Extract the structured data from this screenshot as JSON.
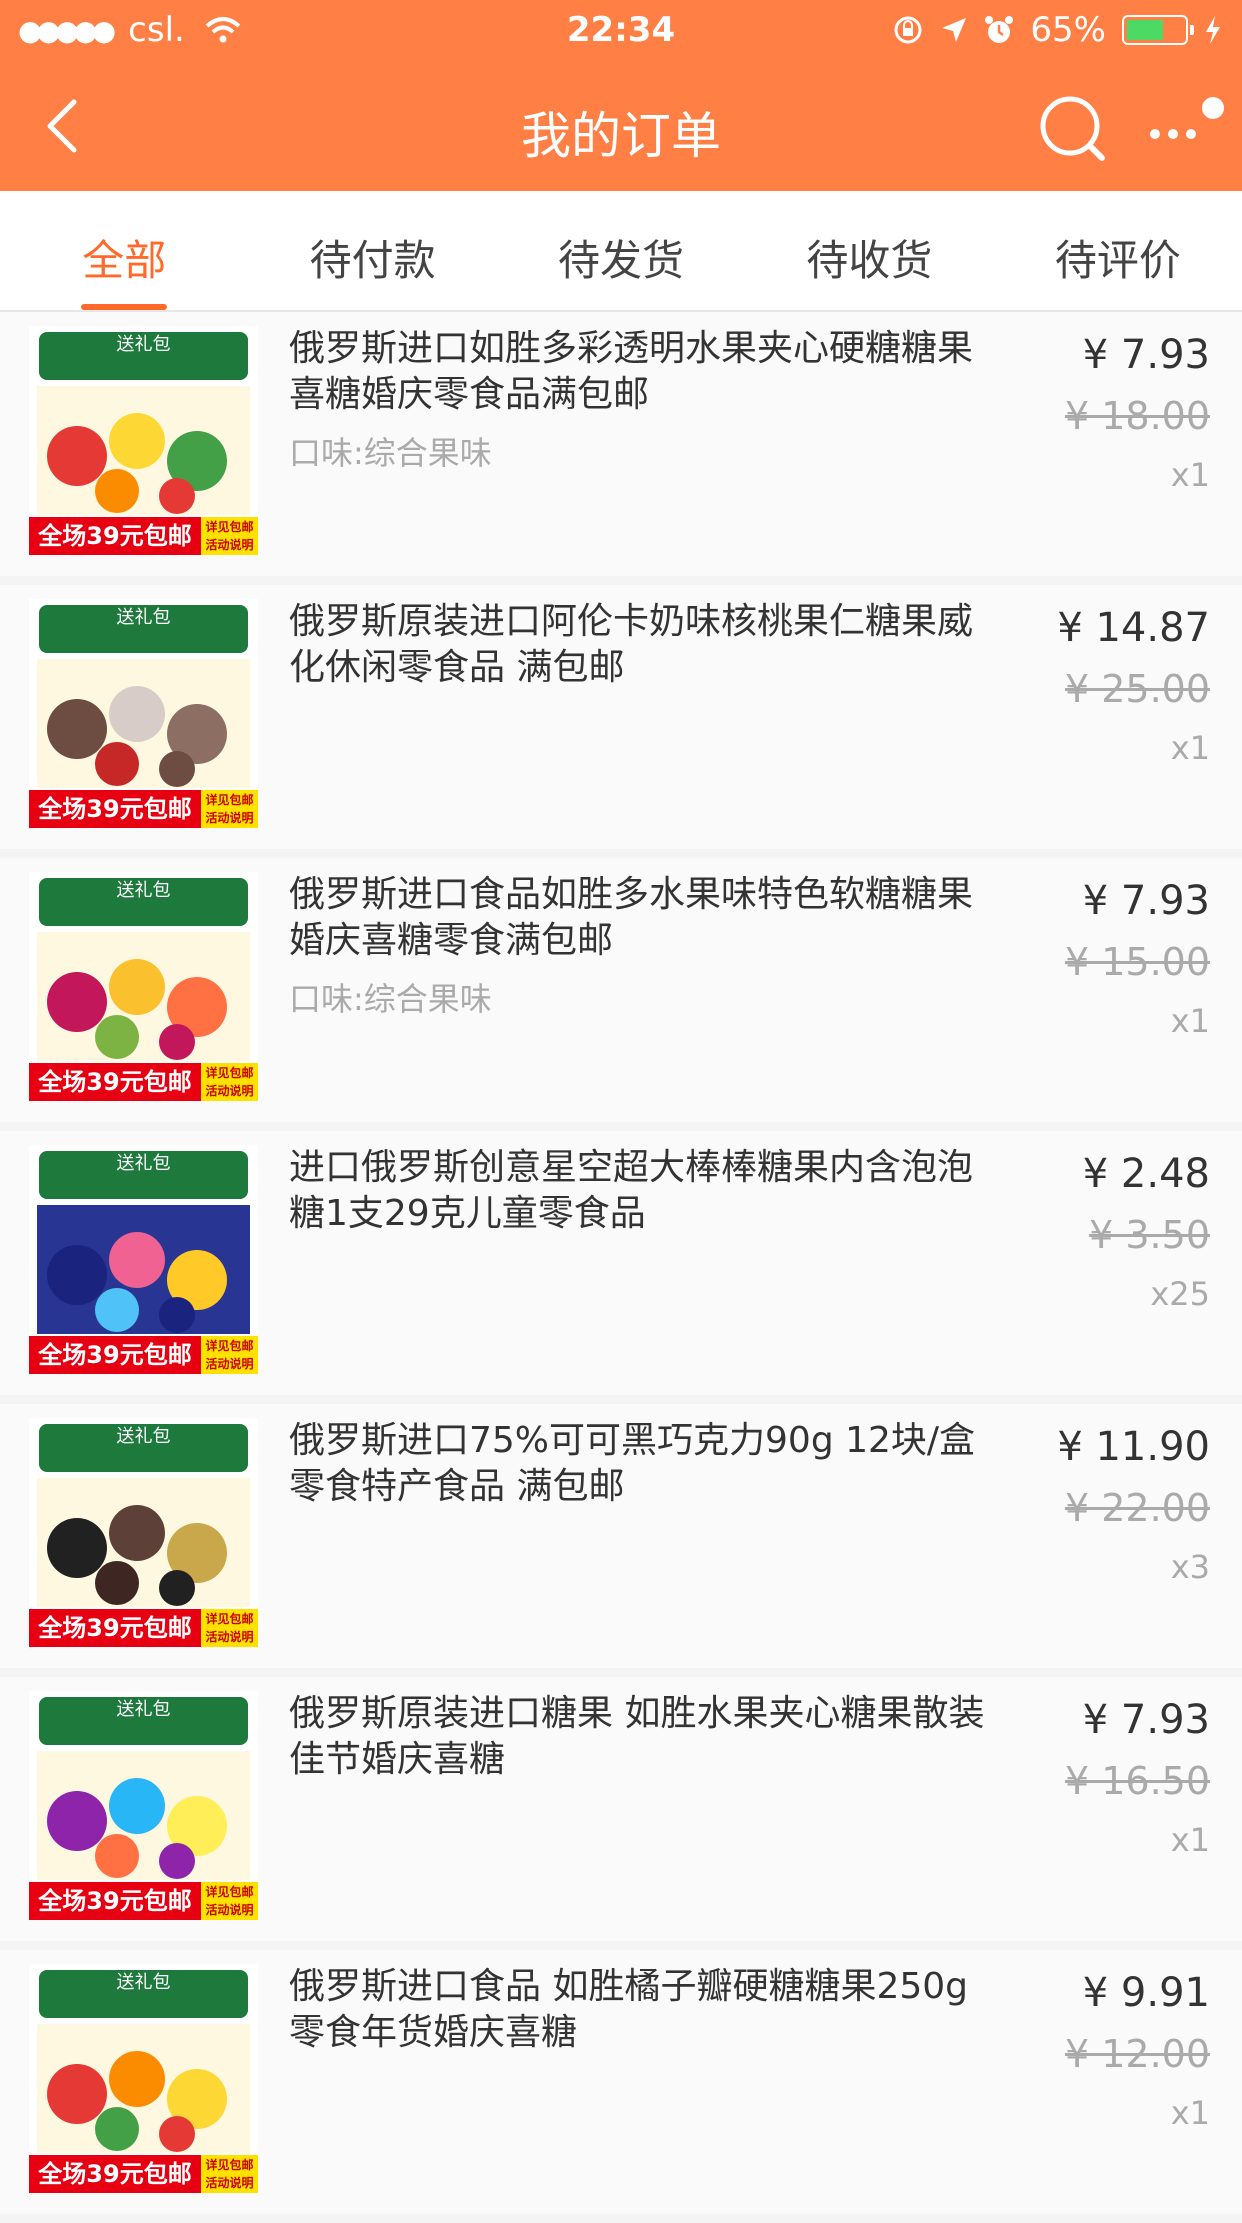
{
  "status_bar": {
    "signal": "●●●●●",
    "carrier": "csl.",
    "time": "22:34",
    "battery": "65%",
    "battery_level": 0.65
  },
  "nav": {
    "title": "我的订单"
  },
  "tabs": [
    {
      "label": "全部",
      "active": true
    },
    {
      "label": "待付款",
      "active": false
    },
    {
      "label": "待发货",
      "active": false
    },
    {
      "label": "待收货",
      "active": false
    },
    {
      "label": "待评价",
      "active": false
    }
  ],
  "thumbnail_text": {
    "banner": "送礼包",
    "promo": "全场39元包邮",
    "promo_side": "详见包邮 活动说明"
  },
  "orders": [
    {
      "name": "俄罗斯进口如胜多彩透明水果夹心硬糖糖果 喜糖婚庆零食品满包邮",
      "spec": "口味:综合果味",
      "price": "¥ 7.93",
      "original_price": "¥ 18.00",
      "quantity": "x1"
    },
    {
      "name": "俄罗斯原装进口阿伦卡奶味核桃果仁糖果威化休闲零食品 满包邮",
      "spec": "",
      "price": "¥ 14.87",
      "original_price": "¥ 25.00",
      "quantity": "x1"
    },
    {
      "name": "俄罗斯进口食品如胜多水果味特色软糖糖果 婚庆喜糖零食满包邮",
      "spec": "口味:综合果味",
      "price": "¥ 7.93",
      "original_price": "¥ 15.00",
      "quantity": "x1"
    },
    {
      "name": "进口俄罗斯创意星空超大棒棒糖果内含泡泡糖1支29克儿童零食品",
      "spec": "",
      "price": "¥ 2.48",
      "original_price": "¥ 3.50",
      "quantity": "x25"
    },
    {
      "name": "俄罗斯进口75%可可黑巧克力90g 12块/盒零食特产食品 满包邮",
      "spec": "",
      "price": "¥ 11.90",
      "original_price": "¥ 22.00",
      "quantity": "x3"
    },
    {
      "name": "俄罗斯原装进口糖果 如胜水果夹心糖果散装佳节婚庆喜糖",
      "spec": "",
      "price": "¥ 7.93",
      "original_price": "¥ 16.50",
      "quantity": "x1"
    },
    {
      "name": "俄罗斯进口食品 如胜橘子瓣硬糖糖果250g零食年货婚庆喜糖",
      "spec": "",
      "price": "¥ 9.91",
      "original_price": "¥ 12.00",
      "quantity": "x1"
    }
  ],
  "colors": {
    "header": "#ff7f45",
    "accent": "#ff6a2b"
  },
  "icons": {
    "back": "chevron-left-icon",
    "search": "search-icon",
    "more": "more-icon"
  }
}
